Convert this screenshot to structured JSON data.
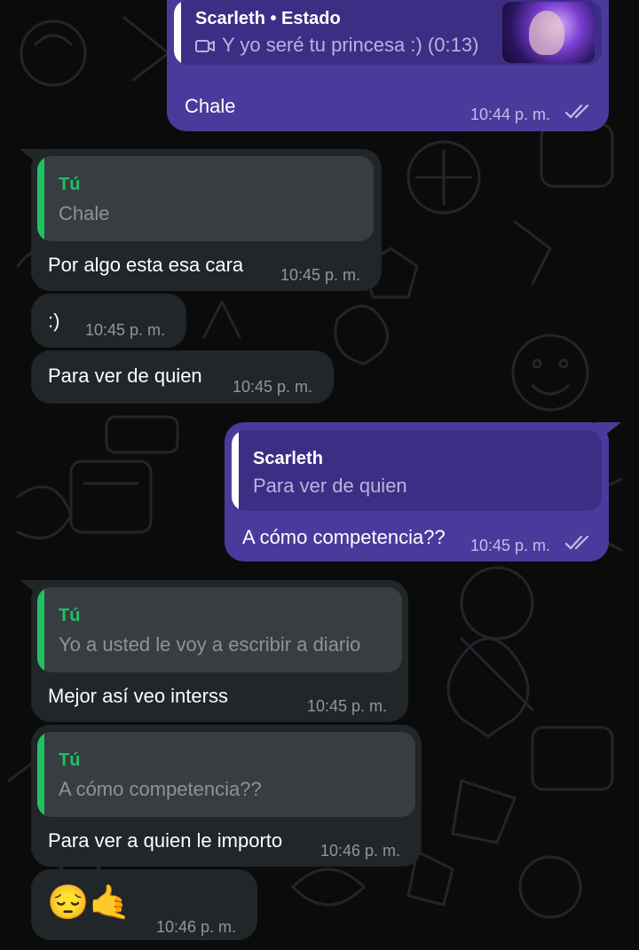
{
  "chat": {
    "messages": [
      {
        "direction": "out",
        "reply": {
          "name": "Scarleth • Estado",
          "media": "video-icon",
          "text": "Y yo seré tu princesa :) (0:13)"
        },
        "text": "Chale",
        "time": "10:44 p. m.",
        "status": "read"
      },
      {
        "direction": "in",
        "reply": {
          "name": "Tú",
          "text": "Chale"
        },
        "text": "Por algo esta esa cara",
        "time": "10:45 p. m."
      },
      {
        "direction": "in",
        "text": ":)",
        "time": "10:45 p. m."
      },
      {
        "direction": "in",
        "text": "Para ver de quien",
        "time": "10:45 p. m."
      },
      {
        "direction": "out",
        "reply": {
          "name": "Scarleth",
          "text": "Para ver de quien"
        },
        "text": "A cómo competencia??",
        "time": "10:45 p. m.",
        "status": "read"
      },
      {
        "direction": "in",
        "reply": {
          "name": "Tú",
          "text": "Yo a usted le voy a escribir a diario"
        },
        "text": "Mejor así  veo interss",
        "time": "10:45 p. m."
      },
      {
        "direction": "in",
        "reply": {
          "name": "Tú",
          "text": "A cómo competencia??"
        },
        "text": "Para ver a quien le importo",
        "time": "10:46 p. m."
      },
      {
        "direction": "in",
        "text": "😔🤙",
        "time": "10:46 p. m."
      }
    ]
  },
  "colors": {
    "outgoing_bubble": "#4a3a9c",
    "incoming_bubble": "#212629",
    "reply_accent_incoming": "#21c063",
    "background": "#0b0b0c",
    "read_ticks": "#c4bde8"
  }
}
